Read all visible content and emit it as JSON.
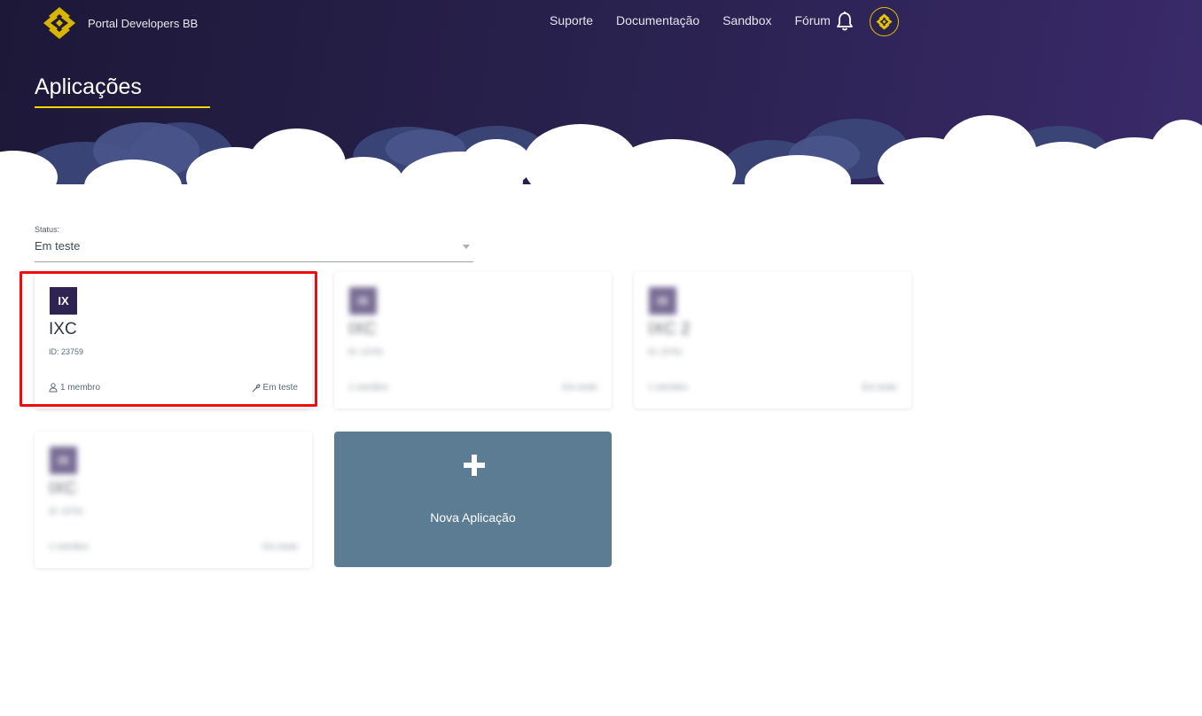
{
  "header": {
    "brand_name": "Portal Developers BB",
    "nav": [
      "Suporte",
      "Documentação",
      "Sandbox",
      "Fórum"
    ],
    "icons": {
      "logo": "bb-logo-icon",
      "notifications": "bell-icon",
      "avatar": "bb-logo-icon"
    },
    "colors": {
      "hero_dark": "#1d1838",
      "hero_light": "#3a2a6a",
      "accent_yellow": "#f5d400"
    }
  },
  "page": {
    "title": "Aplicações"
  },
  "filter": {
    "label": "Status:",
    "value": "Em teste"
  },
  "cards": [
    {
      "badge": "IX",
      "name": "IXC",
      "id_text": "ID: 23759",
      "members": "1 membro",
      "status": "Em teste",
      "blurred": false
    },
    {
      "badge": "IX",
      "name": "IXC",
      "id_text": "ID: 23760",
      "members": "1 membro",
      "status": "Em teste",
      "blurred": true
    },
    {
      "badge": "IX",
      "name": "IXC 2",
      "id_text": "ID: 23761",
      "members": "1 membro",
      "status": "Em teste",
      "blurred": true
    },
    {
      "badge": "IX",
      "name": "IXC",
      "id_text": "ID: 23762",
      "members": "1 membro",
      "status": "Em teste",
      "blurred": true
    }
  ],
  "new_app": {
    "label": "Nova Aplicação",
    "icon": "plus-icon",
    "color": "#5b7c93"
  },
  "highlight": {
    "color": "#ee0c0c"
  }
}
